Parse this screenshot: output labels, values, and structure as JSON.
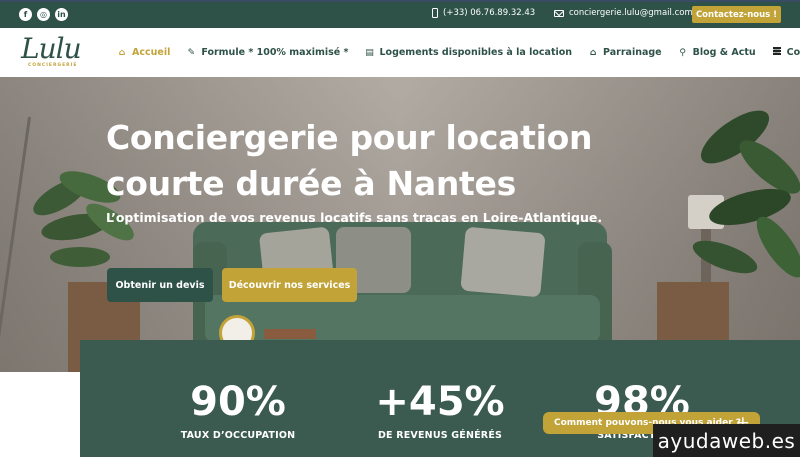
{
  "topbar": {
    "socials": [
      {
        "name": "facebook-icon",
        "glyph": "f"
      },
      {
        "name": "instagram-icon",
        "glyph": "◎"
      },
      {
        "name": "linkedin-icon",
        "glyph": "in"
      }
    ],
    "phone": "(+33) 06.76.89.32.43",
    "email": "conciergerie.lulu@gmail.com",
    "contact_button": "Contactez-nous !"
  },
  "logo": {
    "word": "Lulu",
    "sub": "CONCIERGERIE"
  },
  "nav": {
    "items": [
      {
        "label": "Accueil",
        "icon": "⌂"
      },
      {
        "label": "Formule * 100% maximisé *",
        "icon": "✎"
      },
      {
        "label": "Logements disponibles à la location",
        "icon": "▤"
      },
      {
        "label": "Parrainage",
        "icon": "⌂"
      },
      {
        "label": "Blog & Actu",
        "icon": "⚲"
      },
      {
        "label": "Contact",
        "icon": "✉"
      }
    ]
  },
  "hero": {
    "title": "Conciergerie pour location courte durée à Nantes",
    "subtitle": "L’optimisation de vos revenus locatifs sans tracas en Loire-Atlantique.",
    "btn_devis": "Obtenir un devis",
    "btn_services": "Découvrir nos services"
  },
  "stats": [
    {
      "value": "90%",
      "label": "TAUX D’OCCUPATION"
    },
    {
      "value": "+45%",
      "label": "DE REVENUS GÉNÉRÉS"
    },
    {
      "value": "98%",
      "label": "SATISFACTION V"
    }
  ],
  "help": {
    "label": "Comment pouvons-nous vous aider ?",
    "plus": "+"
  },
  "watermark": "ayudaweb.es",
  "colors": {
    "primary_green": "#2e5248",
    "gold": "#c2a338",
    "stats_bg": "#3b5b50"
  }
}
